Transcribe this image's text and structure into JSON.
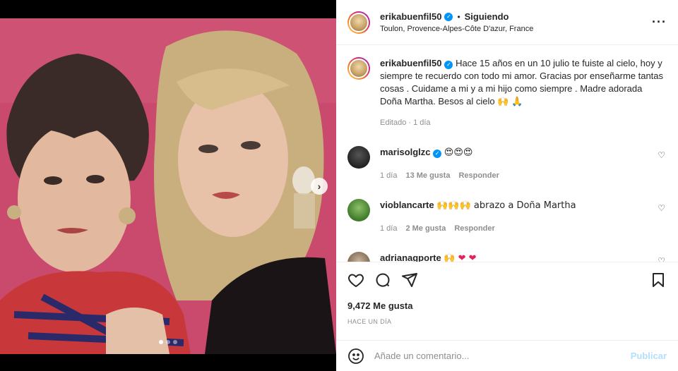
{
  "post": {
    "username": "erikabuenfil50",
    "verified": true,
    "following_label": "Siguiendo",
    "location": "Toulon, Provence-Alpes-Côte D'azur, France",
    "more_icon": "more-horizontal-icon",
    "image": {
      "description_icon": "photo",
      "carousel_count": 3,
      "carousel_index": 1
    }
  },
  "caption": {
    "username": "erikabuenfil50",
    "text": "Hace 15 años en un 10 julio te fuiste al cielo, hoy y siempre te recuerdo con todo mi amor. Gracias por enseñarme tantas cosas . Cuidame a mi y a mi hijo como siempre . Madre adorada Doña Martha. Besos al cielo 🙌 🙏",
    "meta": "Editado · 1 día"
  },
  "comments": [
    {
      "username": "marisolglzc",
      "verified": true,
      "text": "😍😍😍",
      "time": "1 día",
      "likes": "13 Me gusta",
      "reply": "Responder"
    },
    {
      "username": "vioblancarte",
      "verified": false,
      "text": "🙌🙌🙌 abrazo a Doña Martha",
      "time": "1 día",
      "likes": "2 Me gusta",
      "reply": "Responder"
    },
    {
      "username": "adrianagporte",
      "verified": false,
      "text": "🙌 ❤ ❤",
      "time": "",
      "likes": "",
      "reply": ""
    }
  ],
  "likes_count": "9,472 Me gusta",
  "posted_time": "HACE UN DÍA",
  "add_comment": {
    "placeholder": "Añade un comentario...",
    "publish_label": "Publicar"
  },
  "colors": {
    "accent": "#0095f6",
    "publish_disabled": "#b2dffc",
    "muted": "#8e8e8e"
  }
}
